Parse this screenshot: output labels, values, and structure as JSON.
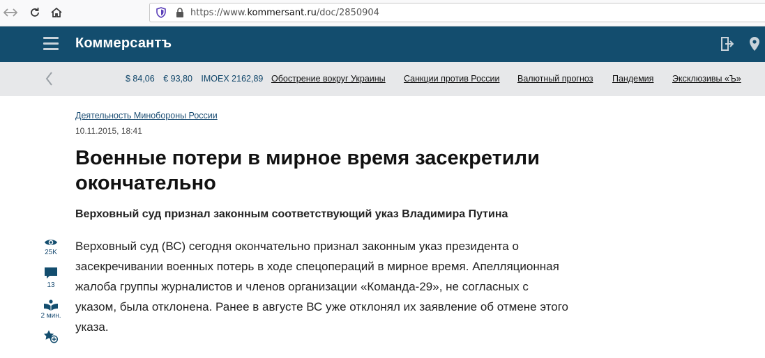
{
  "browser": {
    "url_prefix": "https://www.",
    "url_domain": "kommersant.ru",
    "url_path": "/doc/2850904"
  },
  "header": {
    "logo": "Коммерсантъ"
  },
  "ticker": {
    "quotes": [
      "$ 84,06",
      "€ 93,80",
      "IMOEX 2162,89"
    ],
    "links": [
      "Обострение вокруг Украины",
      "Санкции против России",
      "Валютный прогноз",
      "Пандемия",
      "Эксклюзивы «Ъ»"
    ]
  },
  "article": {
    "rubric": "Деятельность Минобороны России",
    "date": "10.11.2015, 18:41",
    "title_line1": "Военные потери в мирное время засекретили",
    "title_line2": "окончательно",
    "subtitle": "Верховный суд признал законным соответствующий указ Владимира Путина",
    "body_lines": [
      "Верховный суд (ВС) сегодня окончательно признал законным указ президента о",
      "засекречивании военных потерь в ходе спецопераций в мирное время. Апелляционная",
      "жалоба группы журналистов и членов организации «Команда-29», не согласных с",
      "указом, была отклонена. Ранее в августе ВС уже отклонял их заявление об отмене этого",
      "указа."
    ]
  },
  "tools": {
    "views": "25K",
    "comments": "13",
    "read_time": "2 мин."
  },
  "colors": {
    "header_bg": "#134d6e",
    "ticker_bg": "#e7e8ea",
    "accent": "#1b4d73"
  },
  "icons": [
    "back-arrow-icon",
    "forward-arrow-icon",
    "reload-icon",
    "home-icon",
    "shield-icon",
    "lock-icon",
    "hamburger-menu-icon",
    "login-icon",
    "location-pin-icon",
    "chevron-left-icon",
    "eye-icon",
    "comment-icon",
    "book-icon",
    "favorite-add-icon"
  ]
}
